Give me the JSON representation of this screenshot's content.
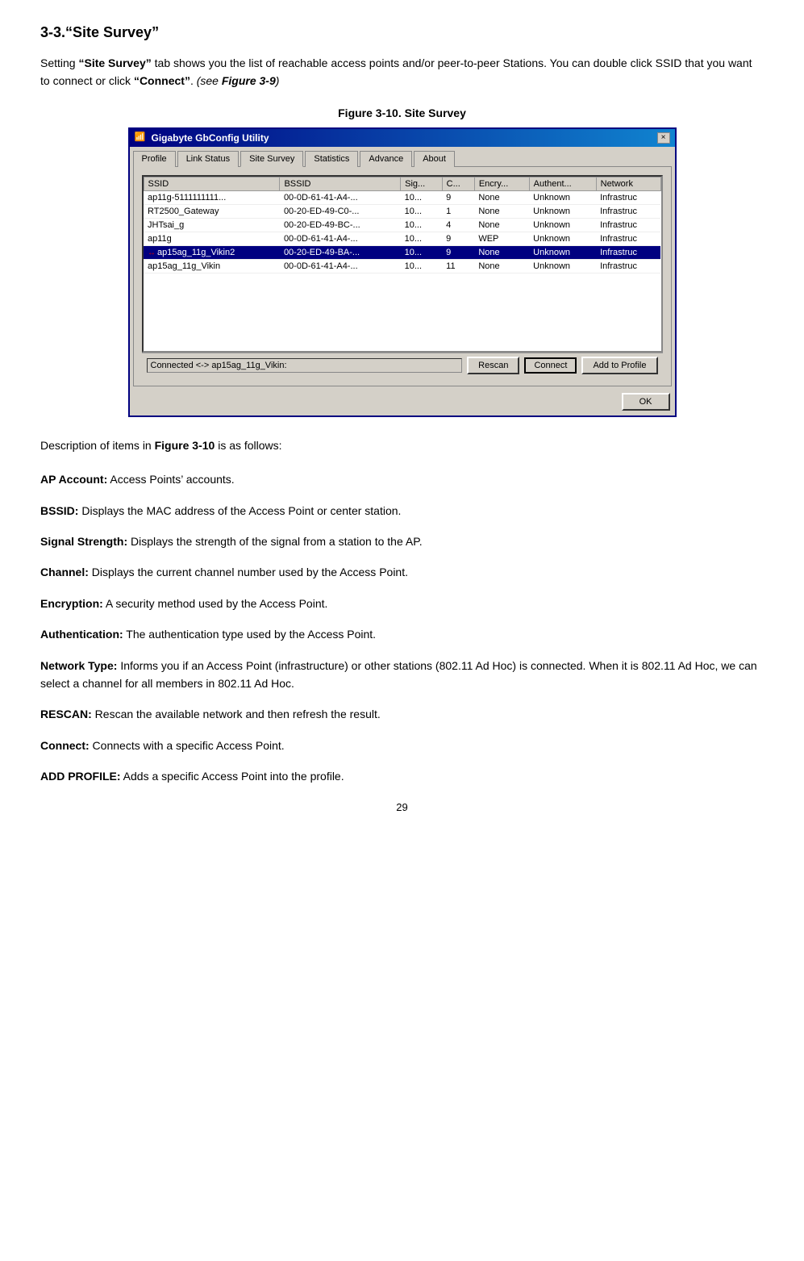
{
  "page": {
    "section_title": "3-3.“Site Survey”",
    "intro_text_1": "Setting “Site Survey” tab shows you the list of reachable access points and/or peer-to-peer Stations. You can double click SSID that you want to connect or click “Connect”.",
    "intro_text_2": "(see Figure 3-9)",
    "figure_caption": "Figure 3-10.",
    "figure_caption_suffix": "  Site Survey",
    "description_intro": "Description of items in ",
    "description_intro_bold": "Figure 3-10",
    "description_intro_suffix": " is as follows:",
    "page_number": "29"
  },
  "dialog": {
    "title": "Gigabyte GbConfig Utility",
    "close_btn": "×",
    "tabs": [
      {
        "id": "profile",
        "label": "Profile"
      },
      {
        "id": "link-status",
        "label": "Link Status"
      },
      {
        "id": "site-survey",
        "label": "Site Survey",
        "active": true
      },
      {
        "id": "statistics",
        "label": "Statistics"
      },
      {
        "id": "advance",
        "label": "Advance"
      },
      {
        "id": "about",
        "label": "About"
      }
    ],
    "table": {
      "columns": [
        "SSID",
        "BSSID",
        "Sig...",
        "C...",
        "Encry...",
        "Authent...",
        "Network"
      ],
      "rows": [
        {
          "ssid": "ap11g-5111111111...",
          "bssid": "00-0D-61-41-A4-...",
          "sig": "10...",
          "ch": "9",
          "enc": "None",
          "auth": "Unknown",
          "net": "Infrastruc",
          "selected": false,
          "icon": false
        },
        {
          "ssid": "RT2500_Gateway",
          "bssid": "00-20-ED-49-C0-...",
          "sig": "10...",
          "ch": "1",
          "enc": "None",
          "auth": "Unknown",
          "net": "Infrastruc",
          "selected": false,
          "icon": false
        },
        {
          "ssid": "JHTsai_g",
          "bssid": "00-20-ED-49-BC-...",
          "sig": "10...",
          "ch": "4",
          "enc": "None",
          "auth": "Unknown",
          "net": "Infrastruc",
          "selected": false,
          "icon": false
        },
        {
          "ssid": "ap11g",
          "bssid": "00-0D-61-41-A4-...",
          "sig": "10...",
          "ch": "9",
          "enc": "WEP",
          "auth": "Unknown",
          "net": "Infrastruc",
          "selected": false,
          "icon": false
        },
        {
          "ssid": "ap15ag_11g_Vikin2",
          "bssid": "00-20-ED-49-BA-...",
          "sig": "10...",
          "ch": "9",
          "enc": "None",
          "auth": "Unknown",
          "net": "Infrastruc",
          "selected": true,
          "icon": true
        },
        {
          "ssid": "ap15ag_11g_Vikin",
          "bssid": "00-0D-61-41-A4-...",
          "sig": "10...",
          "ch": "11",
          "enc": "None",
          "auth": "Unknown",
          "net": "Infrastruc",
          "selected": false,
          "icon": false
        }
      ]
    },
    "status_text": "Connected <-> ap15ag_11g_Vikin:",
    "rescan_btn": "Rescan",
    "connect_btn": "Connect",
    "add_profile_btn": "Add to Profile",
    "ok_btn": "OK"
  },
  "descriptions": [
    {
      "id": "ap-account",
      "bold": "AP Account:",
      "text": " Access Points’ accounts."
    },
    {
      "id": "bssid",
      "bold": "BSSID:",
      "text": " Displays the MAC address of the Access Point or center station."
    },
    {
      "id": "signal",
      "bold": "Signal Strength:",
      "text": " Displays the strength of the signal from a station to the AP."
    },
    {
      "id": "channel",
      "bold": "Channel:",
      "text": " Displays the current channel number used by the Access Point."
    },
    {
      "id": "encryption",
      "bold": "Encryption:",
      "text": " A security method used by the Access Point."
    },
    {
      "id": "authentication",
      "bold": "Authentication:",
      "text": " The authentication type used by the Access Point."
    },
    {
      "id": "network-type",
      "bold": "Network Type:",
      "text": " Informs you if an Access Point (infrastructure) or other stations (802.11 Ad Hoc) is connected. When it is 802.11 Ad Hoc, we can select a channel for all members in 802.11 Ad Hoc."
    },
    {
      "id": "rescan",
      "bold": "RESCAN:",
      "text": " Rescan the available network and then refresh the result."
    },
    {
      "id": "connect",
      "bold": "Connect:",
      "text": " Connects with a specific Access Point."
    },
    {
      "id": "add-profile",
      "bold": "ADD PROFILE:",
      "text": " Adds a specific Access Point into the profile."
    }
  ]
}
